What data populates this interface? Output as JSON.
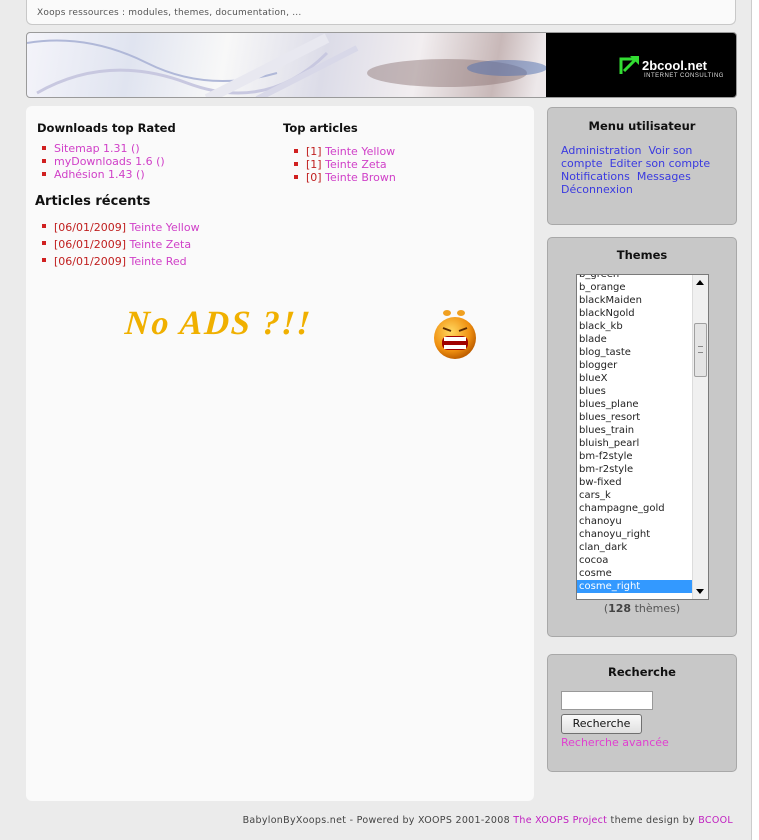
{
  "topbar": {
    "text": "Xoops ressources : modules, themes, documentation, ..."
  },
  "banner": {
    "logo_text": "2bcool.net",
    "logo_sub": "INTERNET CONSULTING"
  },
  "downloads": {
    "title": "Downloads top Rated",
    "items": [
      "Sitemap 1.31 ()",
      "myDownloads 1.6 ()",
      "Adhésion 1.43 ()"
    ]
  },
  "top_articles": {
    "title": "Top articles",
    "items": [
      {
        "count": "[1]",
        "label": "Teinte Yellow"
      },
      {
        "count": "[1]",
        "label": "Teinte Zeta"
      },
      {
        "count": "[0]",
        "label": "Teinte Brown"
      }
    ]
  },
  "recent_articles": {
    "title": "Articles récents",
    "items": [
      {
        "date": "[06/01/2009]",
        "label": "Teinte Yellow"
      },
      {
        "date": "[06/01/2009]",
        "label": "Teinte Zeta"
      },
      {
        "date": "[06/01/2009]",
        "label": "Teinte Red"
      }
    ]
  },
  "noads": {
    "text": "No ADS ?!!"
  },
  "user_menu": {
    "title": "Menu utilisateur",
    "links": [
      "Administration",
      "Voir son compte",
      "Editer son compte",
      "Notifications",
      "Messages",
      "Déconnexion"
    ]
  },
  "themes": {
    "title": "Themes",
    "options": [
      "b_green",
      "b_orange",
      "blackMaiden",
      "blackNgold",
      "black_kb",
      "blade",
      "blog_taste",
      "blogger",
      "blueX",
      "blues",
      "blues_plane",
      "blues_resort",
      "blues_train",
      "bluish_pearl",
      "bm-f2style",
      "bm-r2style",
      "bw-fixed",
      "cars_k",
      "champagne_gold",
      "chanoyu",
      "chanoyu_right",
      "clan_dark",
      "cocoa",
      "cosme",
      "cosme_right"
    ],
    "selected": "cosme_right",
    "count_prefix": "(",
    "count": "128",
    "count_suffix": " thèmes)"
  },
  "search": {
    "title": "Recherche",
    "input_value": "",
    "button": "Recherche",
    "advanced": "Recherche avancée"
  },
  "footer": {
    "prefix": "BabylonByXoops.net - Powered by XOOPS 2001-2008 ",
    "project_link": "The XOOPS Project",
    "middle": " theme design by ",
    "author_link": "BCOOL"
  },
  "colors": {
    "link": "#d040c8",
    "bullet": "#d02020",
    "menu_link": "#3a3ae0",
    "selection": "#3399ff"
  }
}
